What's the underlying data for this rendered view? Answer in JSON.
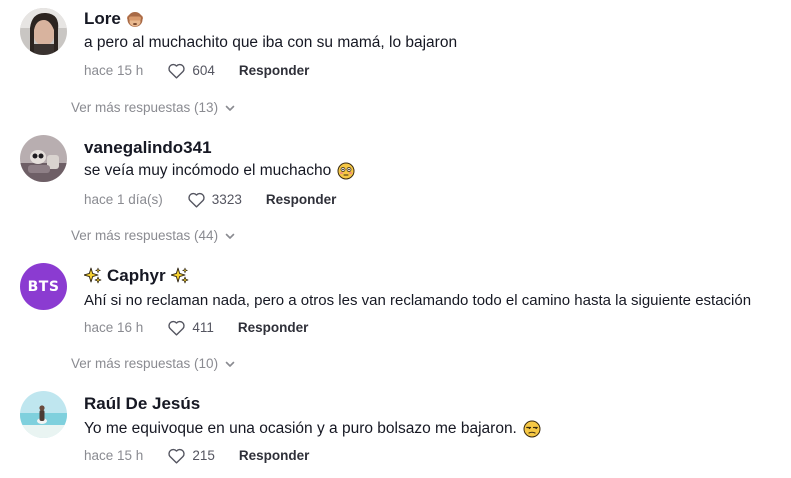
{
  "comments": [
    {
      "username": "Lore",
      "text": "a pero al muchachito que iba con su mamá, lo bajaron",
      "time": "hace 15 h",
      "likes": "604",
      "reply_label": "Responder",
      "more_replies": "Ver más respuestas (13)",
      "avatar": "user-photo"
    },
    {
      "username": "vanegalindo341",
      "text": "se veía muy incómodo el muchacho",
      "time": "hace 1 día(s)",
      "likes": "3323",
      "reply_label": "Responder",
      "more_replies": "Ver más respuestas (44)",
      "avatar": "user-photo"
    },
    {
      "username": "Caphyr",
      "text": "Ahí si no reclaman nada, pero a otros les van reclamando todo el camino hasta la siguiente estación",
      "time": "hace 16 h",
      "likes": "411",
      "reply_label": "Responder",
      "more_replies": "Ver más respuestas (10)",
      "avatar_text": "BTS",
      "avatar_color": "#8b3bd1"
    },
    {
      "username": "Raúl De Jesús",
      "text": "Yo me equivoque en una ocasión y a puro bolsazo me bajaron.",
      "time": "hace 15 h",
      "likes": "215",
      "reply_label": "Responder",
      "avatar": "user-photo"
    }
  ],
  "icons": {
    "like": "heart-outline-icon",
    "expand": "chevron-down-icon",
    "monkey": "see-no-evil-monkey-emoji",
    "flushed": "flushed-face-emoji",
    "sparkles": "sparkles-emoji",
    "unamused": "unamused-face-emoji"
  },
  "colors": {
    "text_primary": "#161823",
    "text_secondary": "#8a8b91",
    "reply": "#2f3039"
  }
}
